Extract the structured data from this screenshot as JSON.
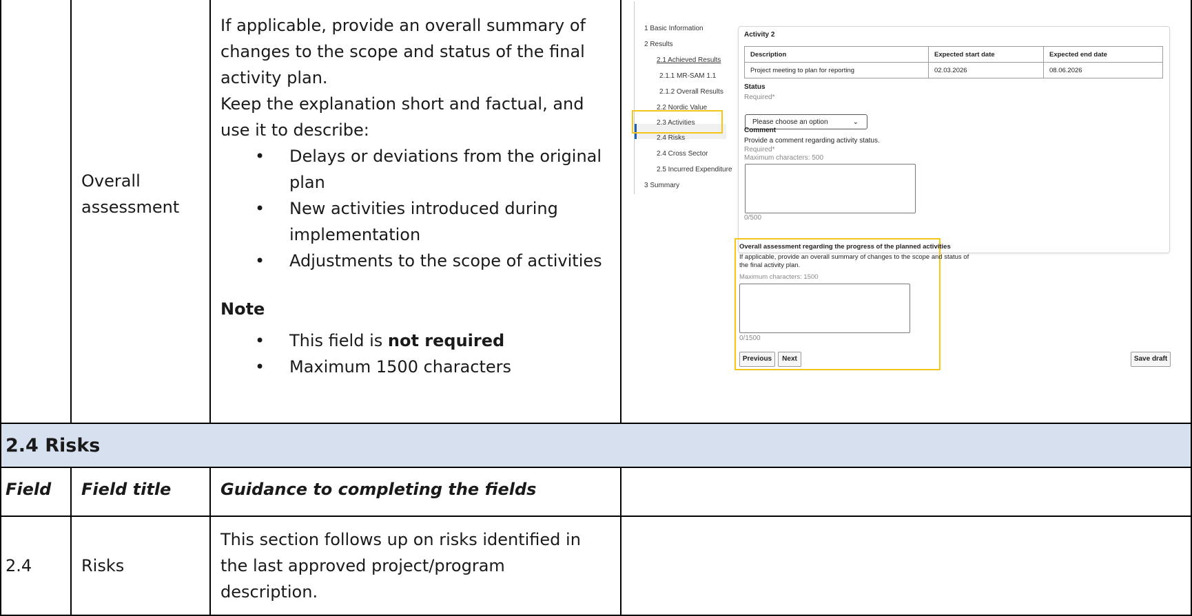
{
  "row_overall": {
    "field_title_line1": "Overall",
    "field_title_line2": "assessment",
    "guidance_line1": "If applicable, provide an overall summary of",
    "guidance_line2": "changes to the scope and status of the final",
    "guidance_line3": "activity plan.",
    "guidance_line4": "Keep the explanation short and factual, and",
    "guidance_line5": "use it to describe:",
    "bullet1_line1": "Delays or deviations from the original",
    "bullet1_line2": "plan",
    "bullet2_line1": "New activities introduced during",
    "bullet2_line2": "implementation",
    "bullet3": "Adjustments to the scope of activities",
    "note_title": "Note",
    "note_bullet1_prefix": "This field is ",
    "note_bullet1_bold": "not required",
    "note_bullet2": "Maximum 1500 characters"
  },
  "screenshot": {
    "nav": [
      "1 Basic Information",
      "2 Results",
      "2.1 Achieved Results",
      "2.1.1 MR-SAM 1.1",
      "2.1.2 Overall Results",
      "2.2 Nordic Value",
      "2.3 Activities",
      "2.4 Risks",
      "2.4 Cross Sector",
      "2.5 Incurred Expenditure",
      "3 Summary"
    ],
    "activity_title": "Activity 2",
    "table_headers": [
      "Description",
      "Expected start date",
      "Expected end date"
    ],
    "table_row": [
      "Project meeting to plan for reporting",
      "02.03.2026",
      "08.06.2026"
    ],
    "status_label": "Status",
    "status_required": "Required*",
    "status_select_value": "Please choose an option",
    "comment_label": "Comment",
    "comment_help": "Provide a comment regarding activity status.",
    "comment_required": "Required*",
    "comment_max": "Maximum characters: 500",
    "comment_counter": "0/500",
    "overall_title": "Overall assessment regarding the progress of the planned activities",
    "overall_help_line1": "If applicable, provide an overall summary of changes to the scope and status of",
    "overall_help_line2": "the final activity plan.",
    "overall_max": "Maximum characters: 1500",
    "overall_counter": "0/1500",
    "previous_button": "Previous",
    "next_button": "Next",
    "save_draft_button": "Save draft"
  },
  "section_risks": {
    "title": "2.4 Risks",
    "header_field": "Field",
    "header_field_title": "Field title",
    "header_guidance": "Guidance to completing the fields",
    "row_field": "2.4",
    "row_title": "Risks",
    "row_guidance_line1": "This section follows up on risks identified in",
    "row_guidance_line2": "the last approved project/program",
    "row_guidance_line3": "description."
  },
  "colors": {
    "section_band": "#d6e0ee",
    "highlight": "#f5c518",
    "active_nav_accent": "#1b5fb5"
  }
}
